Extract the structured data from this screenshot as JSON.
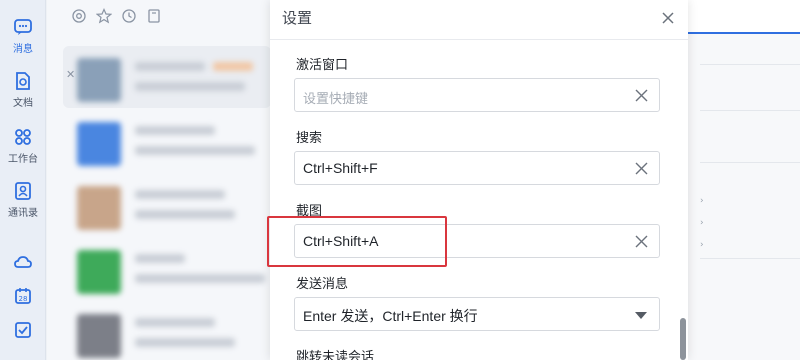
{
  "nav": {
    "items": [
      {
        "label": "消息",
        "icon": "chat-icon"
      },
      {
        "label": "文档",
        "icon": "doc-icon"
      },
      {
        "label": "工作台",
        "icon": "workbench-icon"
      },
      {
        "label": "通讯录",
        "icon": "contacts-icon"
      }
    ],
    "extra_icons": [
      "cloud-icon",
      "calendar-icon",
      "todo-icon"
    ],
    "calendar_day": "28"
  },
  "dialog": {
    "title": "设置",
    "fields": [
      {
        "label": "激活窗口",
        "value": "",
        "placeholder": "设置快捷键"
      },
      {
        "label": "搜索",
        "value": "Ctrl+Shift+F"
      },
      {
        "label": "截图",
        "value": "Ctrl+Shift+A"
      },
      {
        "label": "发送消息",
        "value": "Enter 发送，Ctrl+Enter 换行"
      },
      {
        "label": "跳转未读会话"
      }
    ]
  },
  "colors": {
    "accent": "#2f6fe0",
    "highlight": "#d9363e"
  }
}
